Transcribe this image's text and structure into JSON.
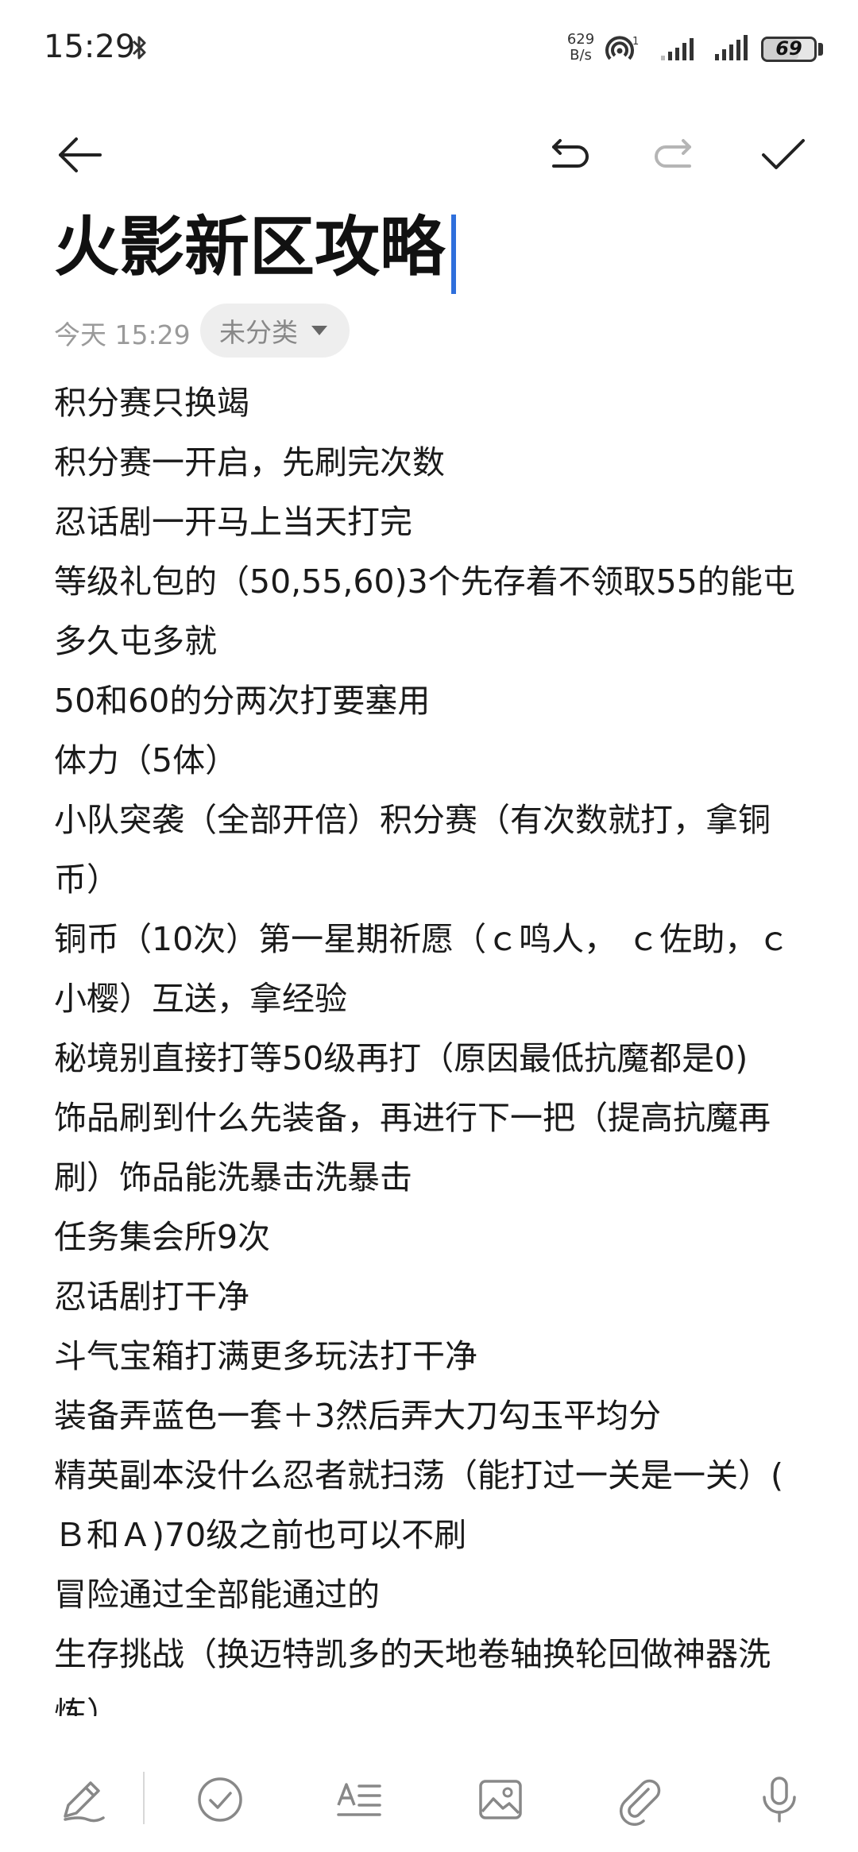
{
  "status_bar": {
    "time": "15:29",
    "net_speed_value": "629",
    "net_speed_unit": "B/s",
    "hotspot_sup": "1",
    "battery": 69,
    "battery_label": "69"
  },
  "toolbar": {
    "icons": [
      "back-arrow-icon",
      "undo-icon",
      "redo-icon",
      "check-icon"
    ]
  },
  "note": {
    "title": "火影新区攻略",
    "date": "今天 15:29",
    "category": "未分类",
    "lines": [
      "积分赛只换竭",
      "积分赛一开启，先刷完次数",
      "忍话剧一开马上当天打完",
      "等级礼包的（50,55,60)3个先存着不领取55的能屯多久屯多就",
      "50和60的分两次打要塞用",
      "体力（5体）",
      "小队突袭（全部开倍）积分赛（有次数就打，拿铜币）",
      "铜币（10次）第一星期祈愿（ｃ鸣人， ｃ佐助，ｃ小樱）互送，拿经验",
      "秘境别直接打等50级再打（原因最低抗魔都是0)",
      "饰品刷到什么先装备，再进行下一把（提高抗魔再刷）饰品能洗暴击洗暴击",
      "任务集会所9次",
      "忍话剧打干净",
      "斗气宝箱打满更多玩法打干净",
      "装备弄蓝色一套＋3然后弄大刀勾玉平均分",
      "精英副本没什么忍者就扫荡（能打过一关是一关）( Ｂ和Ａ)70级之前也可以不刷",
      "冒险通过全部能通过的",
      "生存挑战（换迈特凯多的天地卷轴换轮回做神器洗炼）"
    ]
  },
  "bottom_bar": {
    "icons": [
      "pen-icon",
      "checklist-icon",
      "text-format-icon",
      "image-icon",
      "attachment-icon",
      "microphone-icon"
    ]
  },
  "colors": {
    "cursor": "#2f6fdc",
    "chip_bg": "#eeeeee",
    "meta_text": "#9a9a9a"
  }
}
